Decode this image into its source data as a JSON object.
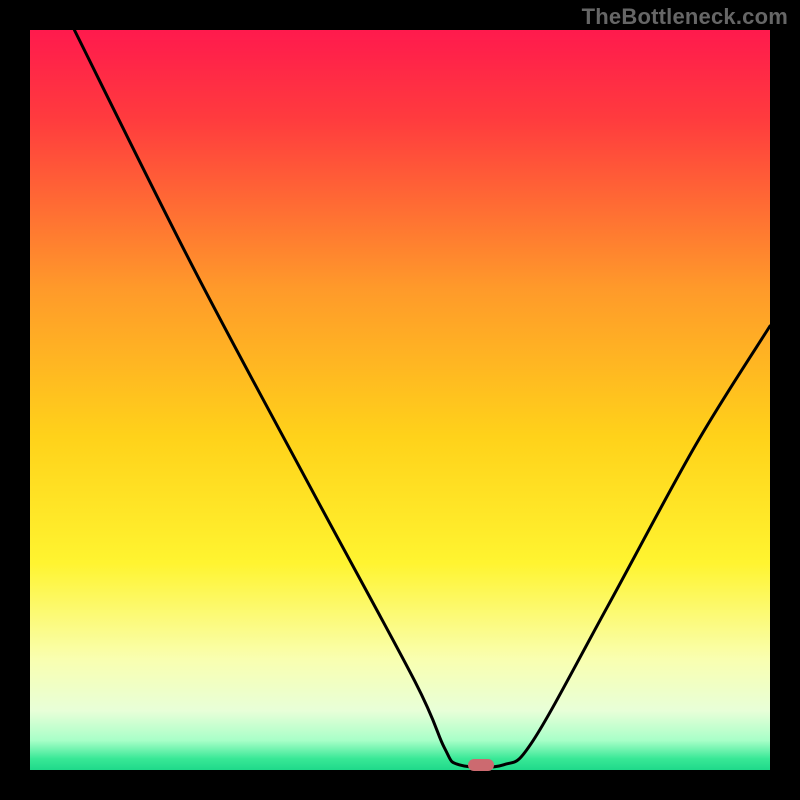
{
  "watermark": "TheBottleneck.com",
  "colors": {
    "frame": "#000000",
    "curve": "#000000",
    "marker": "#cc6a70",
    "watermark_text": "#666666"
  },
  "chart_data": {
    "type": "line",
    "title": "",
    "xlabel": "",
    "ylabel": "",
    "xlim": [
      0,
      100
    ],
    "ylim": [
      0,
      100
    ],
    "grid": false,
    "legend": false,
    "gradient_stops": [
      {
        "pos": 0.0,
        "color": "#ff1a4d"
      },
      {
        "pos": 0.12,
        "color": "#ff3b3e"
      },
      {
        "pos": 0.35,
        "color": "#ff9a2a"
      },
      {
        "pos": 0.55,
        "color": "#ffd21a"
      },
      {
        "pos": 0.72,
        "color": "#fff430"
      },
      {
        "pos": 0.85,
        "color": "#f9ffb0"
      },
      {
        "pos": 0.92,
        "color": "#e8ffd8"
      },
      {
        "pos": 0.96,
        "color": "#a8ffc8"
      },
      {
        "pos": 0.985,
        "color": "#38e896"
      },
      {
        "pos": 1.0,
        "color": "#1fd98a"
      }
    ],
    "series": [
      {
        "name": "bottleneck-curve",
        "points": [
          {
            "x": 6,
            "y": 100
          },
          {
            "x": 22,
            "y": 68
          },
          {
            "x": 38,
            "y": 38
          },
          {
            "x": 52,
            "y": 12
          },
          {
            "x": 56,
            "y": 3
          },
          {
            "x": 58,
            "y": 0.7
          },
          {
            "x": 64,
            "y": 0.7
          },
          {
            "x": 68,
            "y": 4
          },
          {
            "x": 78,
            "y": 22
          },
          {
            "x": 90,
            "y": 44
          },
          {
            "x": 100,
            "y": 60
          }
        ]
      }
    ],
    "marker": {
      "x": 61,
      "y": 0.7
    }
  }
}
